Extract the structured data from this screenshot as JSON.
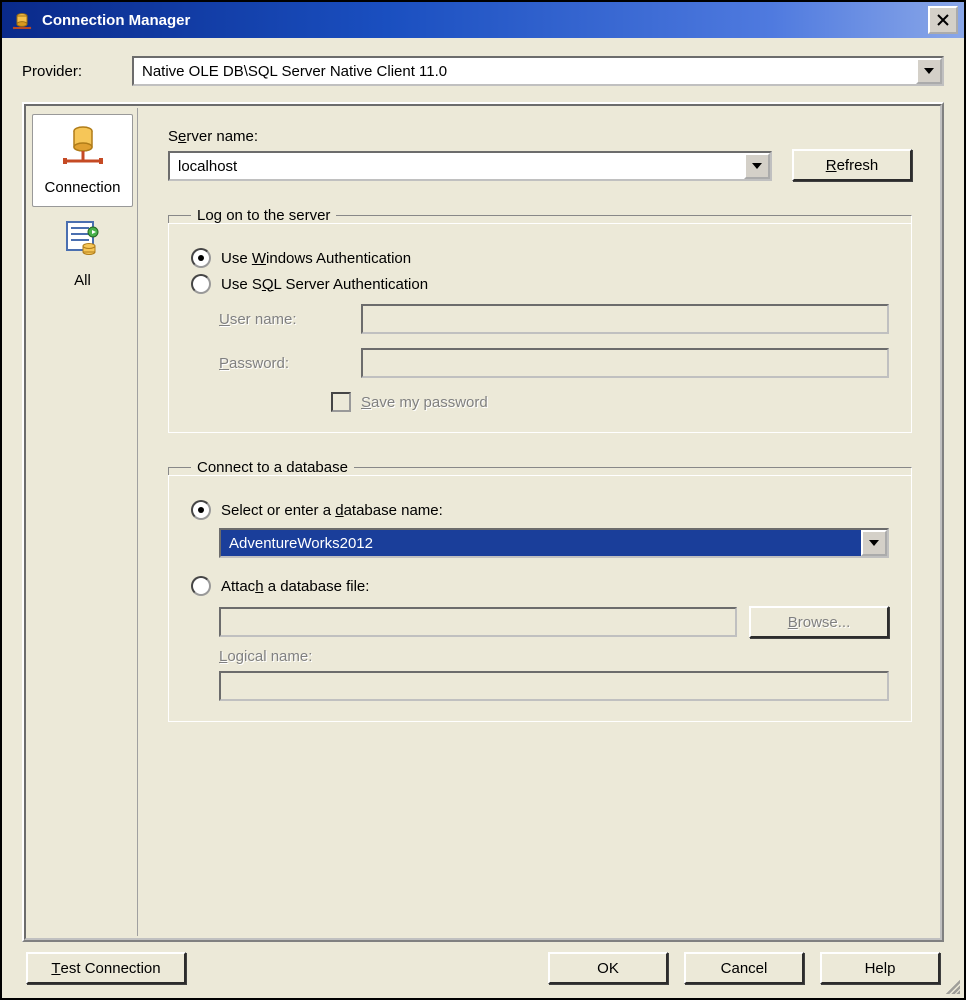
{
  "window": {
    "title": "Connection Manager"
  },
  "provider": {
    "label": "Provider:",
    "value": "Native OLE DB\\SQL Server Native Client 11.0"
  },
  "tabs": {
    "connection": "Connection",
    "all": "All"
  },
  "server": {
    "label": "Server name:",
    "value": "localhost",
    "refresh": "Refresh"
  },
  "logon": {
    "legend": "Log on to the server",
    "windowsAuth": "Use Windows Authentication",
    "sqlAuth": "Use SQL Server Authentication",
    "userLabel": "User name:",
    "userValue": "",
    "passLabel": "Password:",
    "passValue": "",
    "savePass": "Save my password"
  },
  "database": {
    "legend": "Connect to a database",
    "selectOpt": "Select or enter a database name:",
    "dbName": "AdventureWorks2012",
    "attachOpt": "Attach a database file:",
    "attachValue": "",
    "browse": "Browse...",
    "logicalLabel": "Logical name:",
    "logicalValue": ""
  },
  "buttons": {
    "test": "Test Connection",
    "ok": "OK",
    "cancel": "Cancel",
    "help": "Help"
  }
}
